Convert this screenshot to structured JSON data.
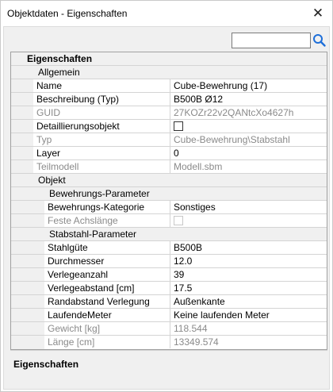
{
  "window": {
    "title": "Objektdaten - Eigenschaften",
    "close_glyph": "✕"
  },
  "search": {
    "value": "",
    "placeholder": ""
  },
  "grid": {
    "sections": {
      "eigenschaften": "Eigenschaften",
      "allgemein": "Allgemein",
      "objekt": "Objekt",
      "bewehrungs_parameter": "Bewehrungs-Parameter",
      "stabstahl_parameter": "Stabstahl-Parameter"
    },
    "allgemein": [
      {
        "name": "Name",
        "value": "Cube-Bewehrung (17)"
      },
      {
        "name": "Beschreibung (Typ)",
        "value": "B500B Ø12"
      },
      {
        "name": "GUID",
        "value": "27KOZr22v2QANtcXo4627h"
      },
      {
        "name": "Detaillierungsobjekt",
        "value": ""
      },
      {
        "name": "Typ",
        "value": "Cube-Bewehrung\\Stabstahl"
      },
      {
        "name": "Layer",
        "value": "0"
      },
      {
        "name": "Teilmodell",
        "value": "Modell.sbm"
      }
    ],
    "bewehrungs": [
      {
        "name": "Bewehrungs-Kategorie",
        "value": "Sonstiges"
      },
      {
        "name": "Feste Achslänge",
        "value": ""
      }
    ],
    "stabstahl": [
      {
        "name": "Stahlgüte",
        "value": "B500B"
      },
      {
        "name": "Durchmesser",
        "value": "12.0"
      },
      {
        "name": "Verlegeanzahl",
        "value": "39"
      },
      {
        "name": "Verlegeabstand [cm]",
        "value": "17.5"
      },
      {
        "name": "Randabstand Verlegung",
        "value": "Außenkante"
      },
      {
        "name": "LaufendeMeter",
        "value": "Keine laufenden Meter"
      },
      {
        "name": "Gewicht [kg]",
        "value": "118.544"
      },
      {
        "name": "Länge [cm]",
        "value": "13349.574"
      }
    ]
  },
  "description": {
    "title": "Eigenschaften"
  },
  "colors": {
    "panel": "#f0f0f0",
    "grid_line": "#d4d4d4",
    "readonly_text": "#8a8a8a",
    "search_icon": "#1e6fd9"
  }
}
